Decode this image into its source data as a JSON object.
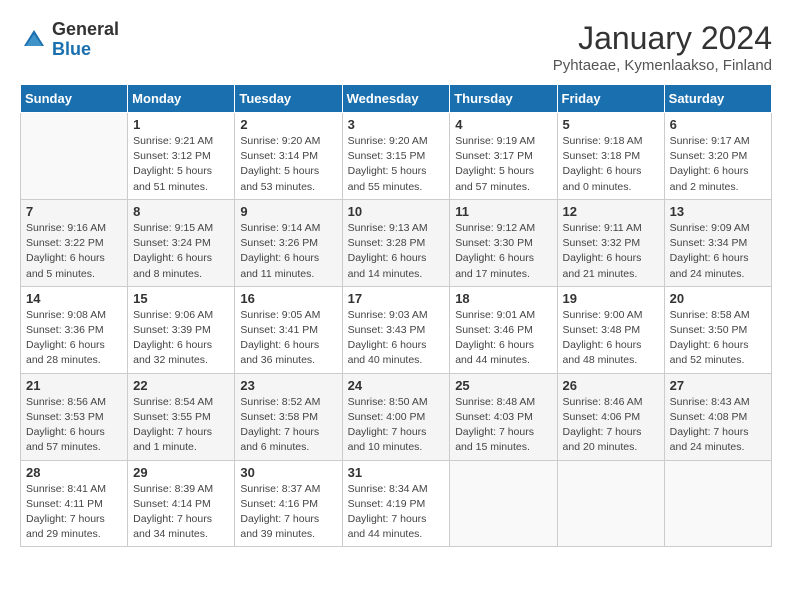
{
  "header": {
    "logo_general": "General",
    "logo_blue": "Blue",
    "month_title": "January 2024",
    "location": "Pyhtaeae, Kymenlaakso, Finland"
  },
  "weekdays": [
    "Sunday",
    "Monday",
    "Tuesday",
    "Wednesday",
    "Thursday",
    "Friday",
    "Saturday"
  ],
  "weeks": [
    [
      {
        "day": "",
        "info": ""
      },
      {
        "day": "1",
        "info": "Sunrise: 9:21 AM\nSunset: 3:12 PM\nDaylight: 5 hours\nand 51 minutes."
      },
      {
        "day": "2",
        "info": "Sunrise: 9:20 AM\nSunset: 3:14 PM\nDaylight: 5 hours\nand 53 minutes."
      },
      {
        "day": "3",
        "info": "Sunrise: 9:20 AM\nSunset: 3:15 PM\nDaylight: 5 hours\nand 55 minutes."
      },
      {
        "day": "4",
        "info": "Sunrise: 9:19 AM\nSunset: 3:17 PM\nDaylight: 5 hours\nand 57 minutes."
      },
      {
        "day": "5",
        "info": "Sunrise: 9:18 AM\nSunset: 3:18 PM\nDaylight: 6 hours\nand 0 minutes."
      },
      {
        "day": "6",
        "info": "Sunrise: 9:17 AM\nSunset: 3:20 PM\nDaylight: 6 hours\nand 2 minutes."
      }
    ],
    [
      {
        "day": "7",
        "info": "Sunrise: 9:16 AM\nSunset: 3:22 PM\nDaylight: 6 hours\nand 5 minutes."
      },
      {
        "day": "8",
        "info": "Sunrise: 9:15 AM\nSunset: 3:24 PM\nDaylight: 6 hours\nand 8 minutes."
      },
      {
        "day": "9",
        "info": "Sunrise: 9:14 AM\nSunset: 3:26 PM\nDaylight: 6 hours\nand 11 minutes."
      },
      {
        "day": "10",
        "info": "Sunrise: 9:13 AM\nSunset: 3:28 PM\nDaylight: 6 hours\nand 14 minutes."
      },
      {
        "day": "11",
        "info": "Sunrise: 9:12 AM\nSunset: 3:30 PM\nDaylight: 6 hours\nand 17 minutes."
      },
      {
        "day": "12",
        "info": "Sunrise: 9:11 AM\nSunset: 3:32 PM\nDaylight: 6 hours\nand 21 minutes."
      },
      {
        "day": "13",
        "info": "Sunrise: 9:09 AM\nSunset: 3:34 PM\nDaylight: 6 hours\nand 24 minutes."
      }
    ],
    [
      {
        "day": "14",
        "info": "Sunrise: 9:08 AM\nSunset: 3:36 PM\nDaylight: 6 hours\nand 28 minutes."
      },
      {
        "day": "15",
        "info": "Sunrise: 9:06 AM\nSunset: 3:39 PM\nDaylight: 6 hours\nand 32 minutes."
      },
      {
        "day": "16",
        "info": "Sunrise: 9:05 AM\nSunset: 3:41 PM\nDaylight: 6 hours\nand 36 minutes."
      },
      {
        "day": "17",
        "info": "Sunrise: 9:03 AM\nSunset: 3:43 PM\nDaylight: 6 hours\nand 40 minutes."
      },
      {
        "day": "18",
        "info": "Sunrise: 9:01 AM\nSunset: 3:46 PM\nDaylight: 6 hours\nand 44 minutes."
      },
      {
        "day": "19",
        "info": "Sunrise: 9:00 AM\nSunset: 3:48 PM\nDaylight: 6 hours\nand 48 minutes."
      },
      {
        "day": "20",
        "info": "Sunrise: 8:58 AM\nSunset: 3:50 PM\nDaylight: 6 hours\nand 52 minutes."
      }
    ],
    [
      {
        "day": "21",
        "info": "Sunrise: 8:56 AM\nSunset: 3:53 PM\nDaylight: 6 hours\nand 57 minutes."
      },
      {
        "day": "22",
        "info": "Sunrise: 8:54 AM\nSunset: 3:55 PM\nDaylight: 7 hours\nand 1 minute."
      },
      {
        "day": "23",
        "info": "Sunrise: 8:52 AM\nSunset: 3:58 PM\nDaylight: 7 hours\nand 6 minutes."
      },
      {
        "day": "24",
        "info": "Sunrise: 8:50 AM\nSunset: 4:00 PM\nDaylight: 7 hours\nand 10 minutes."
      },
      {
        "day": "25",
        "info": "Sunrise: 8:48 AM\nSunset: 4:03 PM\nDaylight: 7 hours\nand 15 minutes."
      },
      {
        "day": "26",
        "info": "Sunrise: 8:46 AM\nSunset: 4:06 PM\nDaylight: 7 hours\nand 20 minutes."
      },
      {
        "day": "27",
        "info": "Sunrise: 8:43 AM\nSunset: 4:08 PM\nDaylight: 7 hours\nand 24 minutes."
      }
    ],
    [
      {
        "day": "28",
        "info": "Sunrise: 8:41 AM\nSunset: 4:11 PM\nDaylight: 7 hours\nand 29 minutes."
      },
      {
        "day": "29",
        "info": "Sunrise: 8:39 AM\nSunset: 4:14 PM\nDaylight: 7 hours\nand 34 minutes."
      },
      {
        "day": "30",
        "info": "Sunrise: 8:37 AM\nSunset: 4:16 PM\nDaylight: 7 hours\nand 39 minutes."
      },
      {
        "day": "31",
        "info": "Sunrise: 8:34 AM\nSunset: 4:19 PM\nDaylight: 7 hours\nand 44 minutes."
      },
      {
        "day": "",
        "info": ""
      },
      {
        "day": "",
        "info": ""
      },
      {
        "day": "",
        "info": ""
      }
    ]
  ]
}
